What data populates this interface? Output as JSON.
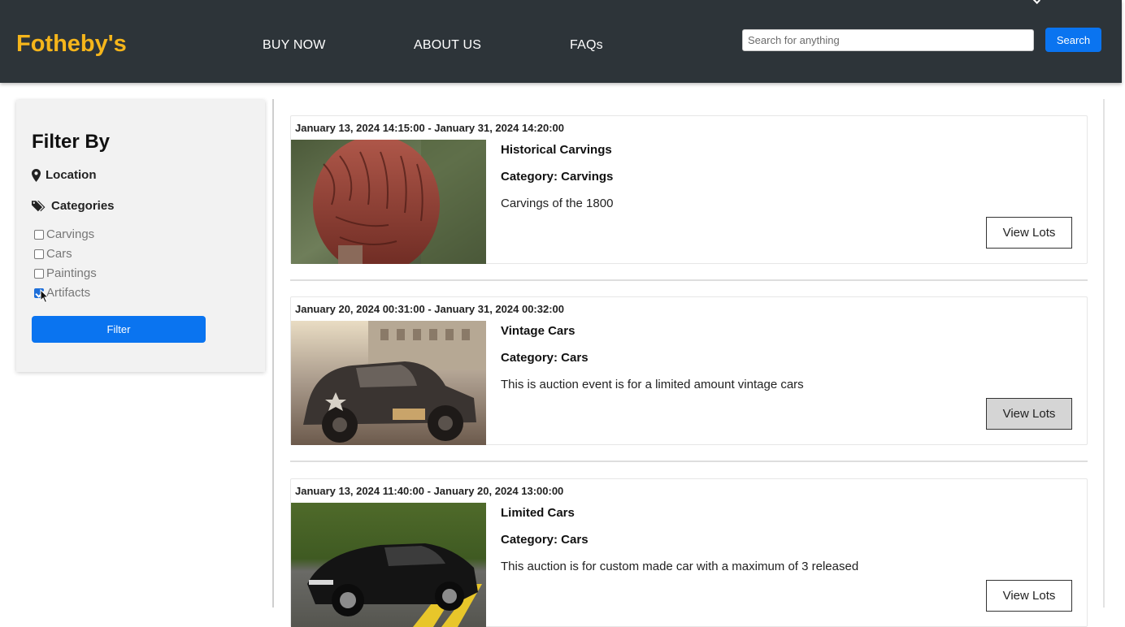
{
  "header": {
    "brand": "Fotheby's",
    "nav": [
      "BUY NOW",
      "ABOUT US",
      "FAQs"
    ],
    "search": {
      "placeholder": "Search for anything",
      "value": ""
    },
    "search_button": "Search"
  },
  "sidebar": {
    "title": "Filter By",
    "location_label": "Location",
    "categories_label": "Categories",
    "categories": [
      {
        "label": "Carvings",
        "checked": false
      },
      {
        "label": "Cars",
        "checked": false
      },
      {
        "label": "Paintings",
        "checked": false
      },
      {
        "label": "Artifacts",
        "checked": true
      }
    ],
    "filter_button": "Filter"
  },
  "auctions": [
    {
      "dates": "January 13, 2024 14:15:00 - January 31, 2024 14:20:00",
      "title": "Historical Carvings",
      "category": "Category: Carvings",
      "description": "Carvings of the 1800",
      "button": "View Lots"
    },
    {
      "dates": "January 20, 2024 00:31:00 - January 31, 2024 00:32:00",
      "title": "Vintage Cars",
      "category": "Category: Cars",
      "description": "This is auction event is for a limited amount vintage cars",
      "button": "View Lots"
    },
    {
      "dates": "January 13, 2024 11:40:00 - January 20, 2024 13:00:00",
      "title": "Limited Cars",
      "category": "Category: Cars",
      "description": "This auction is for custom made car with a maximum of 3 released",
      "button": "View Lots"
    }
  ],
  "icons": {
    "location": "map-marker-icon",
    "categories": "tags-icon",
    "images": [
      "carved-owl-image",
      "vintage-car-image",
      "sports-car-image"
    ]
  },
  "colors": {
    "header_bg": "#2d3439",
    "brand": "#f5b51b",
    "accent": "#0a74f0"
  }
}
